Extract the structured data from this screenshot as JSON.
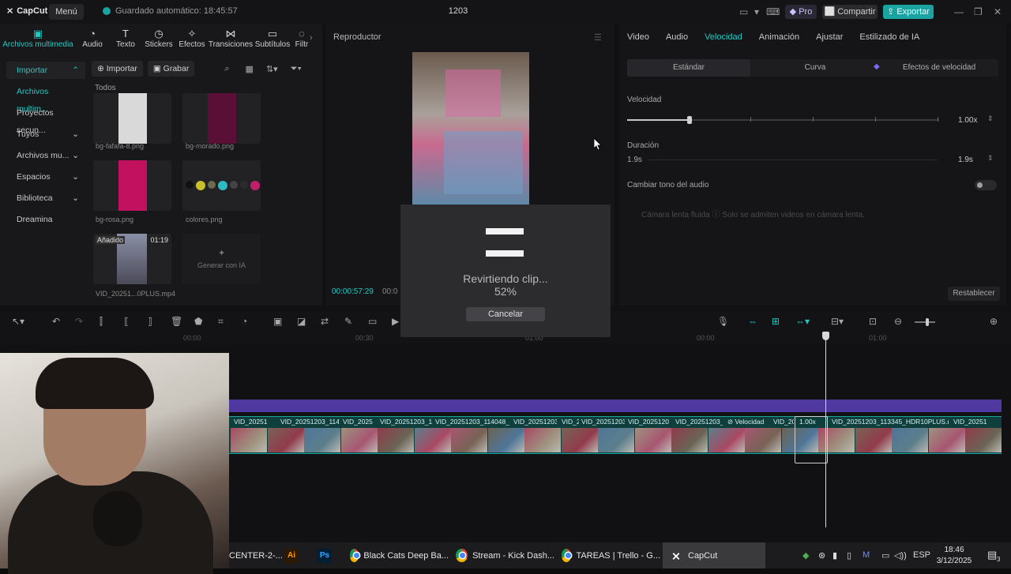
{
  "app": {
    "name": "CapCut",
    "menu_label": "Menú",
    "autosave": "Guardado automático: 18:45:57",
    "project_title": "1203",
    "pro_label": "Pro",
    "share_label": "Compartir",
    "export_label": "Exportar"
  },
  "toolbar": {
    "items": [
      {
        "label": "Archivos multimedia",
        "icon": "media-icon"
      },
      {
        "label": "Audio",
        "icon": "audio-icon"
      },
      {
        "label": "Texto",
        "icon": "text-icon"
      },
      {
        "label": "Stickers",
        "icon": "sticker-icon"
      },
      {
        "label": "Efectos",
        "icon": "effects-icon"
      },
      {
        "label": "Transiciones",
        "icon": "transitions-icon"
      },
      {
        "label": "Subtítulos",
        "icon": "subtitles-icon"
      },
      {
        "label": "Filtr",
        "icon": "filters-icon"
      }
    ]
  },
  "sidebar": {
    "items": [
      {
        "label": "Importar",
        "chevron": "⌃"
      },
      {
        "label": "Archivos multim...",
        "chevron": ""
      },
      {
        "label": "Proyectos secun...",
        "chevron": ""
      },
      {
        "label": "Tuyos",
        "chevron": "⌄"
      },
      {
        "label": "Archivos mu...",
        "chevron": "⌄"
      },
      {
        "label": "Espacios",
        "chevron": "⌄"
      },
      {
        "label": "Biblioteca",
        "chevron": "⌄"
      },
      {
        "label": "Dreamina",
        "chevron": ""
      }
    ]
  },
  "media": {
    "import_label": "Importar",
    "record_label": "Grabar",
    "section": "Todos",
    "tiles": [
      {
        "name": "bg-fafafa-8.png",
        "color": "#d9d9d9"
      },
      {
        "name": "bg-morado.png",
        "color": "#5a1036"
      },
      {
        "name": "bg-rosa.png",
        "color": "#c2125f"
      },
      {
        "name": "colores.png",
        "color": "#222225"
      },
      {
        "name": "VID_20251...0PLUS.mp4",
        "badge": "Añadido",
        "duration": "01:19"
      },
      {
        "name": "Generar con IA"
      }
    ]
  },
  "player": {
    "title": "Reproductor",
    "timecode": "00:00:57:29",
    "timecode_total": "00:0"
  },
  "properties": {
    "tabs": [
      "Video",
      "Audio",
      "Velocidad",
      "Animación",
      "Ajustar",
      "Estilizado de IA"
    ],
    "active_tab": "Velocidad",
    "subtabs": [
      "Estándar",
      "Curva",
      "Efectos de velocidad"
    ],
    "speed_label": "Velocidad",
    "speed_value": "1.00x",
    "speed_fraction": 0.2,
    "duration_label": "Duración",
    "duration_start": "1.9s",
    "duration_end": "1.9s",
    "pitch_label": "Cambiar tono del audio",
    "slowmo_label": "Cámara lenta fluida  ⓘ Solo se admiten videos en cámara lenta.",
    "reset_label": "Restablecer"
  },
  "timeline": {
    "ruler": [
      "00:00",
      "00:30",
      "01:00",
      "00:00",
      "01:00"
    ],
    "clips": [
      "VID_20251",
      "VID_20251203_1140",
      "VID_2025",
      "VID_20251203_1",
      "VID_20251203_114048_H",
      "VID_20251203",
      "VID_2",
      "VID_20251203",
      "VID_2025120",
      "VID_20251203_1",
      "Velocidad",
      "VID_20",
      "1.00x",
      "VID_20251203_113345_HDR10PLUS.mp",
      "VID_20251"
    ]
  },
  "modal": {
    "message": "Revirtiendo clip...",
    "percent": "52%",
    "progress": 0.52,
    "cancel_label": "Cancelar"
  },
  "taskbar": {
    "items": [
      {
        "label": "CENTER-2-...",
        "icon": ""
      },
      {
        "label": "",
        "icon": "Ai"
      },
      {
        "label": "",
        "icon": "Ps"
      },
      {
        "label": "Black Cats Deep Ba...",
        "icon": "chrome"
      },
      {
        "label": "Stream - Kick Dash...",
        "icon": "chrome"
      },
      {
        "label": "TAREAS | Trello - G...",
        "icon": "chrome"
      },
      {
        "label": "CapCut",
        "icon": "capcut"
      }
    ],
    "lang": "ESP",
    "time": "18:46",
    "date": "3/12/2025",
    "notif_count": "3"
  }
}
